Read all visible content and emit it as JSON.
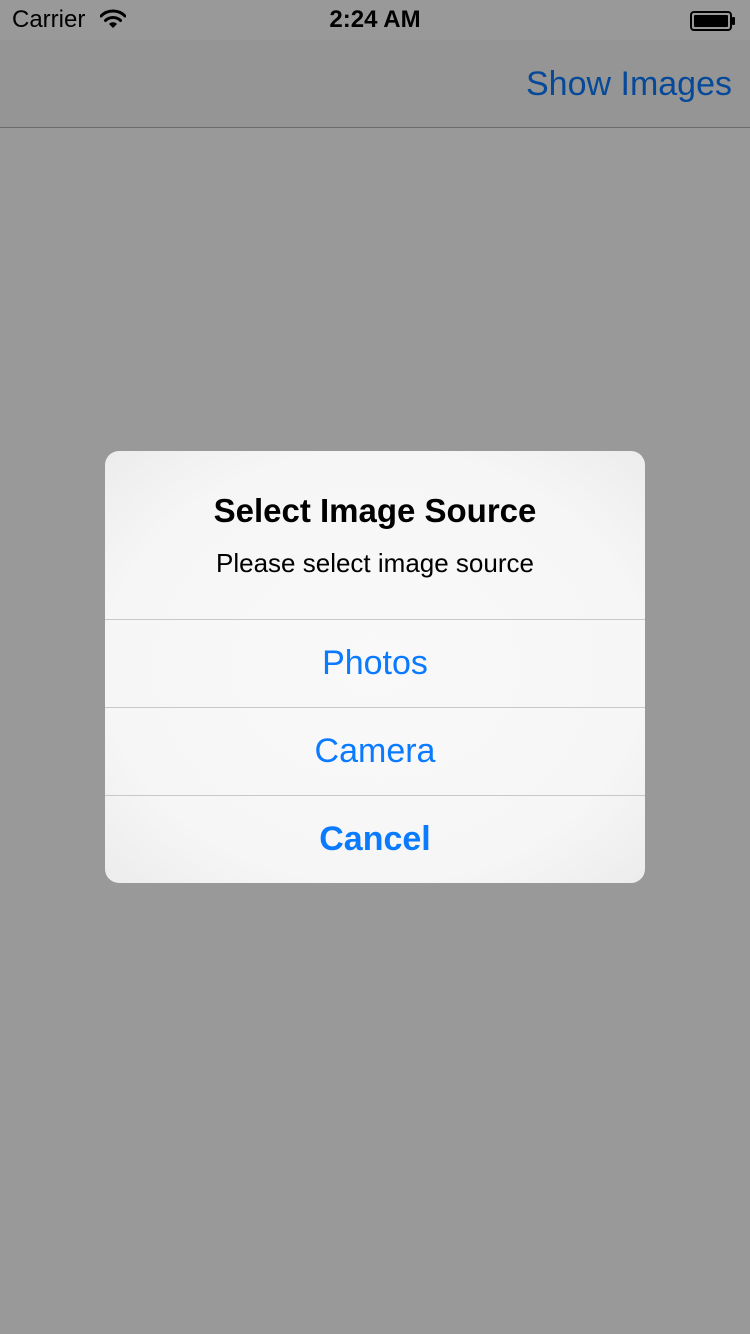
{
  "status_bar": {
    "carrier": "Carrier",
    "time": "2:24 AM"
  },
  "nav_bar": {
    "action_label": "Show Images"
  },
  "alert": {
    "title": "Select Image Source",
    "message": "Please select image source",
    "buttons": [
      {
        "label": "Photos"
      },
      {
        "label": "Camera"
      },
      {
        "label": "Cancel"
      }
    ]
  },
  "colors": {
    "tint": "#0a7aff",
    "dim_overlay": "rgba(0,0,0,0.4)",
    "alert_background": "#f7f7f7",
    "separator": "#c8c8c8"
  },
  "icons": {
    "wifi": "wifi-icon",
    "battery": "battery-icon"
  }
}
